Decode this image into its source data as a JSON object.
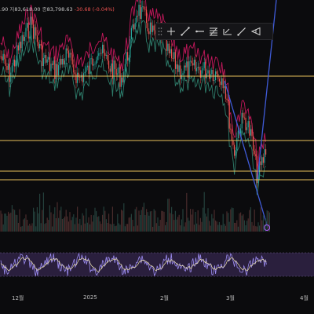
{
  "header": {
    "open_partial": ".90",
    "low_key": "저",
    "low_value": "83,618.00",
    "close_key": "종",
    "close_value": "83,798.63",
    "change": "-30.68 (-0.04%)"
  },
  "toolbar": {
    "tools": [
      "drag-handle-icon",
      "crosshair-icon",
      "trendline-icon",
      "horizontal-ray-icon",
      "fib-retracement-icon",
      "horizontal-line-icon",
      "ray-icon",
      "measure-icon"
    ]
  },
  "xaxis": {
    "labels": [
      "12월",
      "2025",
      "2월",
      "3월",
      "4월"
    ]
  },
  "horizontal_levels": {
    "color": "#e8c25a",
    "count": 4
  },
  "colors": {
    "background": "#0b0b0d",
    "up_candle": "#26a69a",
    "down_candle": "#ef5350",
    "band_upper": "#c2185b",
    "band_lower": "#2e7d6b",
    "trendline": "#3f5bd8",
    "level_line": "#e8c25a",
    "oscillator_line": "#9c8cf0",
    "oscillator_signal": "#f0e6b0",
    "oscillator_band": "#2a1f3d"
  }
}
